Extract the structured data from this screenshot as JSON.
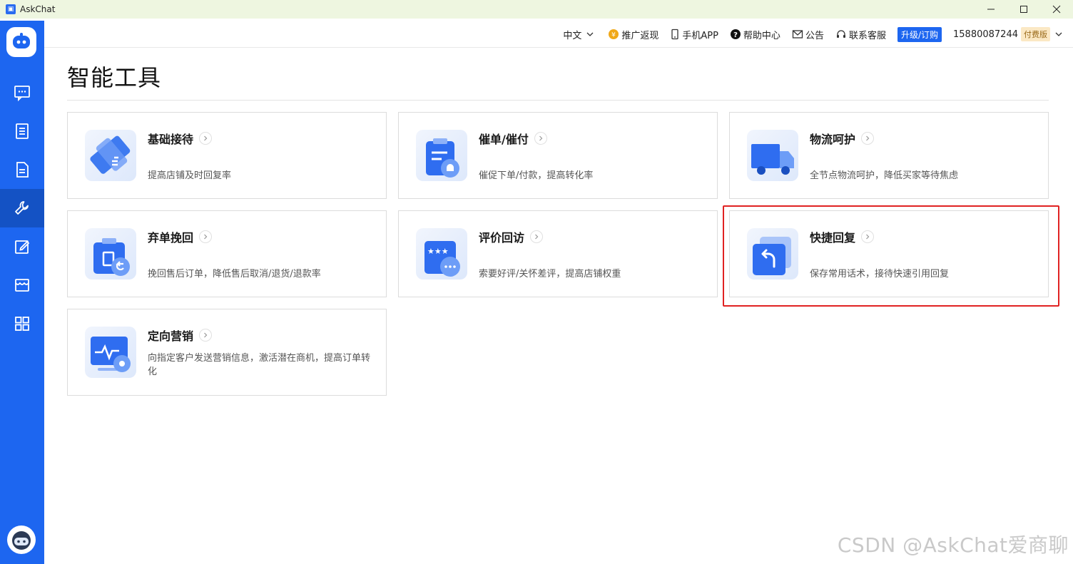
{
  "window": {
    "title": "AskChat"
  },
  "topbar": {
    "language": "中文",
    "promo": "推广返现",
    "mobile_app": "手机APP",
    "help": "帮助中心",
    "notice": "公告",
    "support": "联系客服",
    "upgrade": "升级/订购",
    "phone": "15880087244",
    "plan_badge": "付费版"
  },
  "page": {
    "title": "智能工具"
  },
  "tools": [
    {
      "title": "基础接待",
      "desc": "提高店铺及时回复率",
      "icon": "wrench-icon"
    },
    {
      "title": "催单/催付",
      "desc": "催促下单/付款，提高转化率",
      "icon": "clipboard-bell-icon"
    },
    {
      "title": "物流呵护",
      "desc": "全节点物流呵护，降低买家等待焦虑",
      "icon": "truck-icon"
    },
    {
      "title": "弃单挽回",
      "desc": "挽回售后订单，降低售后取消/退货/退款率",
      "icon": "clipboard-return-icon"
    },
    {
      "title": "评价回访",
      "desc": "索要好评/关怀差评，提高店铺权重",
      "icon": "rating-chat-icon"
    },
    {
      "title": "快捷回复",
      "desc": "保存常用话术，接待快速引用回复",
      "icon": "quick-reply-icon"
    },
    {
      "title": "定向营销",
      "desc": "向指定客户发送营销信息，激活潜在商机，提高订单转化",
      "icon": "monitor-marketing-icon"
    }
  ],
  "sidebar": {
    "items": [
      "chat-icon",
      "orders-icon",
      "document-icon",
      "tools-icon",
      "edit-icon",
      "store-icon",
      "apps-grid-icon"
    ],
    "active_index": 3
  },
  "watermark": "CSDN @AskChat爱商聊",
  "colors": {
    "brand": "#1d66f0",
    "highlight": "#e02222"
  }
}
